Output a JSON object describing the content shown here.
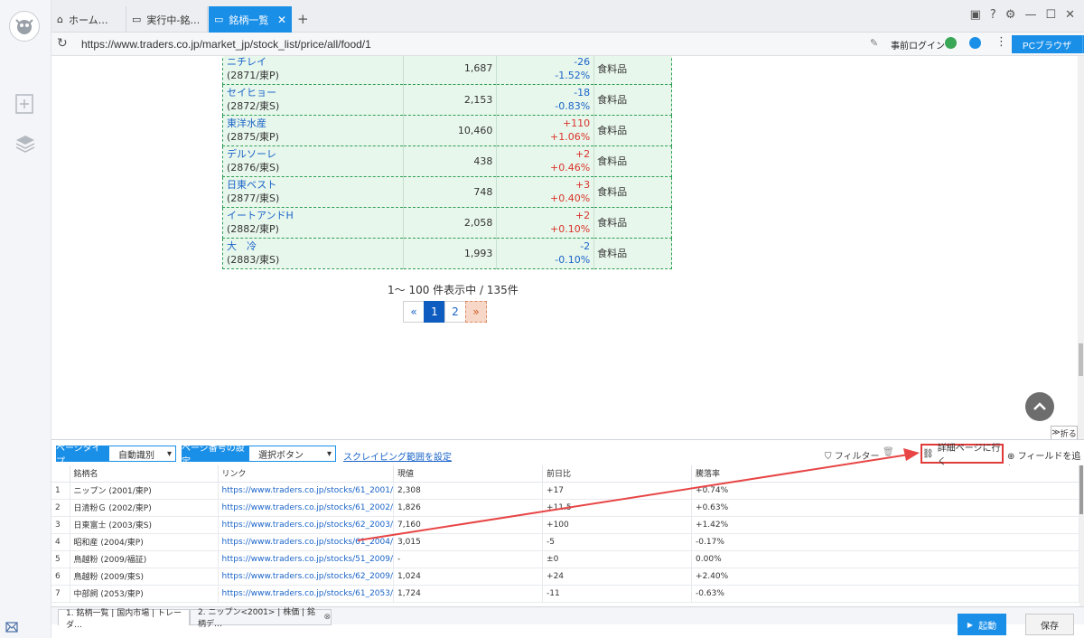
{
  "tabs": [
    {
      "label": "ホーム…",
      "icon": "home-icon"
    },
    {
      "label": "実行中-銘…",
      "icon": "page-icon"
    },
    {
      "label": "銘柄一覧 | …",
      "icon": "page-icon",
      "active": true
    }
  ],
  "address": {
    "url": "https://www.traders.co.jp/market_jp/stock_list/price/all/food/1",
    "login_label": "事前ログイン",
    "browser_button": "PCブラウザ"
  },
  "stocks": [
    {
      "name": "ニチレイ",
      "code": "(2871/東P)",
      "price": "1,687",
      "change": "-26",
      "pct": "-1.52%",
      "dir": "down",
      "sector": "食料品"
    },
    {
      "name": "セイヒョー",
      "code": "(2872/東S)",
      "price": "2,153",
      "change": "-18",
      "pct": "-0.83%",
      "dir": "down",
      "sector": "食料品"
    },
    {
      "name": "東洋水産",
      "code": "(2875/東P)",
      "price": "10,460",
      "change": "+110",
      "pct": "+1.06%",
      "dir": "up",
      "sector": "食料品"
    },
    {
      "name": "デルソーレ",
      "code": "(2876/東S)",
      "price": "438",
      "change": "+2",
      "pct": "+0.46%",
      "dir": "up",
      "sector": "食料品"
    },
    {
      "name": "日東ベスト",
      "code": "(2877/東S)",
      "price": "748",
      "change": "+3",
      "pct": "+0.40%",
      "dir": "up",
      "sector": "食料品"
    },
    {
      "name": "イートアンドH",
      "code": "(2882/東P)",
      "price": "2,058",
      "change": "+2",
      "pct": "+0.10%",
      "dir": "up",
      "sector": "食料品"
    },
    {
      "name": "大　冷",
      "code": "(2883/東S)",
      "price": "1,993",
      "change": "-2",
      "pct": "-0.10%",
      "dir": "down",
      "sector": "食料品"
    }
  ],
  "pagination": {
    "summary": "1〜 100 件表示中 / 135件",
    "prev": "«",
    "pages": [
      "1",
      "2"
    ],
    "next": "»"
  },
  "fold_label": "折る",
  "panel": {
    "page_type_label": "ページタイプ",
    "page_type_value": "自動識別",
    "page_number_label": "ページ番号の設定",
    "page_number_value": "選択ボタン",
    "scrape_range_link": "スクレイピング範囲を設定",
    "filter_label": "フィルター",
    "detail_button": "詳細ページに行く",
    "add_field_button": "フィールドを追加",
    "columns": [
      "銘柄名",
      "リンク",
      "現値",
      "前日比",
      "騰落率"
    ],
    "rows": [
      [
        "1",
        "ニップン (2001/東P)",
        "https://www.traders.co.jp/stocks/61_2001/",
        "2,308",
        "+17",
        "+0.74%"
      ],
      [
        "2",
        "日清粉Ｇ (2002/東P)",
        "https://www.traders.co.jp/stocks/61_2002/",
        "1,826",
        "+11.5",
        "+0.63%"
      ],
      [
        "3",
        "日東富士 (2003/東S)",
        "https://www.traders.co.jp/stocks/62_2003/",
        "7,160",
        "+100",
        "+1.42%"
      ],
      [
        "4",
        "昭和産 (2004/東P)",
        "https://www.traders.co.jp/stocks/61_2004/",
        "3,015",
        "-5",
        "-0.17%"
      ],
      [
        "5",
        "鳥越粉 (2009/福証)",
        "https://www.traders.co.jp/stocks/51_2009/",
        "-",
        "±0",
        "0.00%"
      ],
      [
        "6",
        "鳥越粉 (2009/東S)",
        "https://www.traders.co.jp/stocks/62_2009/",
        "1,024",
        "+24",
        "+2.40%"
      ],
      [
        "7",
        "中部飼 (2053/東P)",
        "https://www.traders.co.jp/stocks/61_2053/",
        "1,724",
        "-11",
        "-0.63%"
      ]
    ]
  },
  "bottom_tabs": [
    {
      "label": "1. 銘柄一覧 | 国内市場 | トレーダ…",
      "active": true
    },
    {
      "label": "2. ニップン<2001> | 株価 | 銘柄デ…",
      "active": false
    }
  ],
  "run_button": "起動",
  "save_button": "保存",
  "colors": {
    "accent": "#1a8fe8",
    "up": "#d9342b",
    "down": "#1a64c8",
    "highlight": "#e03a3a"
  }
}
